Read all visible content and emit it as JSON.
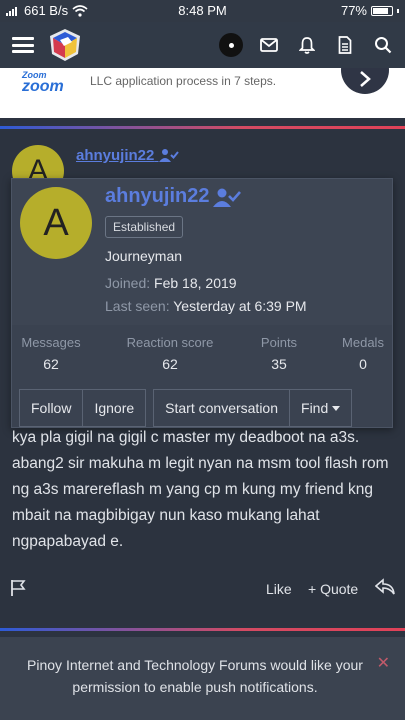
{
  "status_bar": {
    "network_speed": "661 B/s",
    "time": "8:48 PM",
    "battery": "77%"
  },
  "nav": {
    "icons": [
      "menu-icon",
      "logo",
      "dot-button",
      "mail-icon",
      "bell-icon",
      "document-icon",
      "search-icon"
    ]
  },
  "ad": {
    "brand_top": "Zoom",
    "brand": "zoom",
    "text": "LLC application process in 7 steps."
  },
  "post": {
    "avatar_letter": "A",
    "username": "ahnyujin22",
    "body": "kya pla gigil na gigil c master my deadboot na a3s. abang2 sir makuha m legit nyan na msm tool flash rom ng a3s marereflash m yang cp m kung my friend kng mbait na magbibigay nun kaso mukang lahat ngpapabayad e.",
    "like_label": "Like",
    "quote_label": "+ Quote"
  },
  "member_card": {
    "avatar_letter": "A",
    "username": "ahnyujin22",
    "badge": "Established",
    "user_title": "Journeyman",
    "joined_label": "Joined:",
    "joined_value": "Feb 18, 2019",
    "last_seen_label": "Last seen:",
    "last_seen_value": "Yesterday at 6:39 PM",
    "stats": [
      {
        "label": "Messages",
        "value": "62"
      },
      {
        "label": "Reaction score",
        "value": "62"
      },
      {
        "label": "Points",
        "value": "35"
      },
      {
        "label": "Medals",
        "value": "0"
      }
    ],
    "actions": {
      "follow": "Follow",
      "ignore": "Ignore",
      "start_conversation": "Start conversation",
      "find": "Find"
    }
  },
  "push_notice": {
    "text_before": "Pinoy Internet and Technology Forums would like your permission to",
    "link": "enable push notifications",
    "text_after": "."
  },
  "colors": {
    "username": "#5b7dde",
    "avatar": "#b6ae2b",
    "accent": "#d44b63"
  }
}
